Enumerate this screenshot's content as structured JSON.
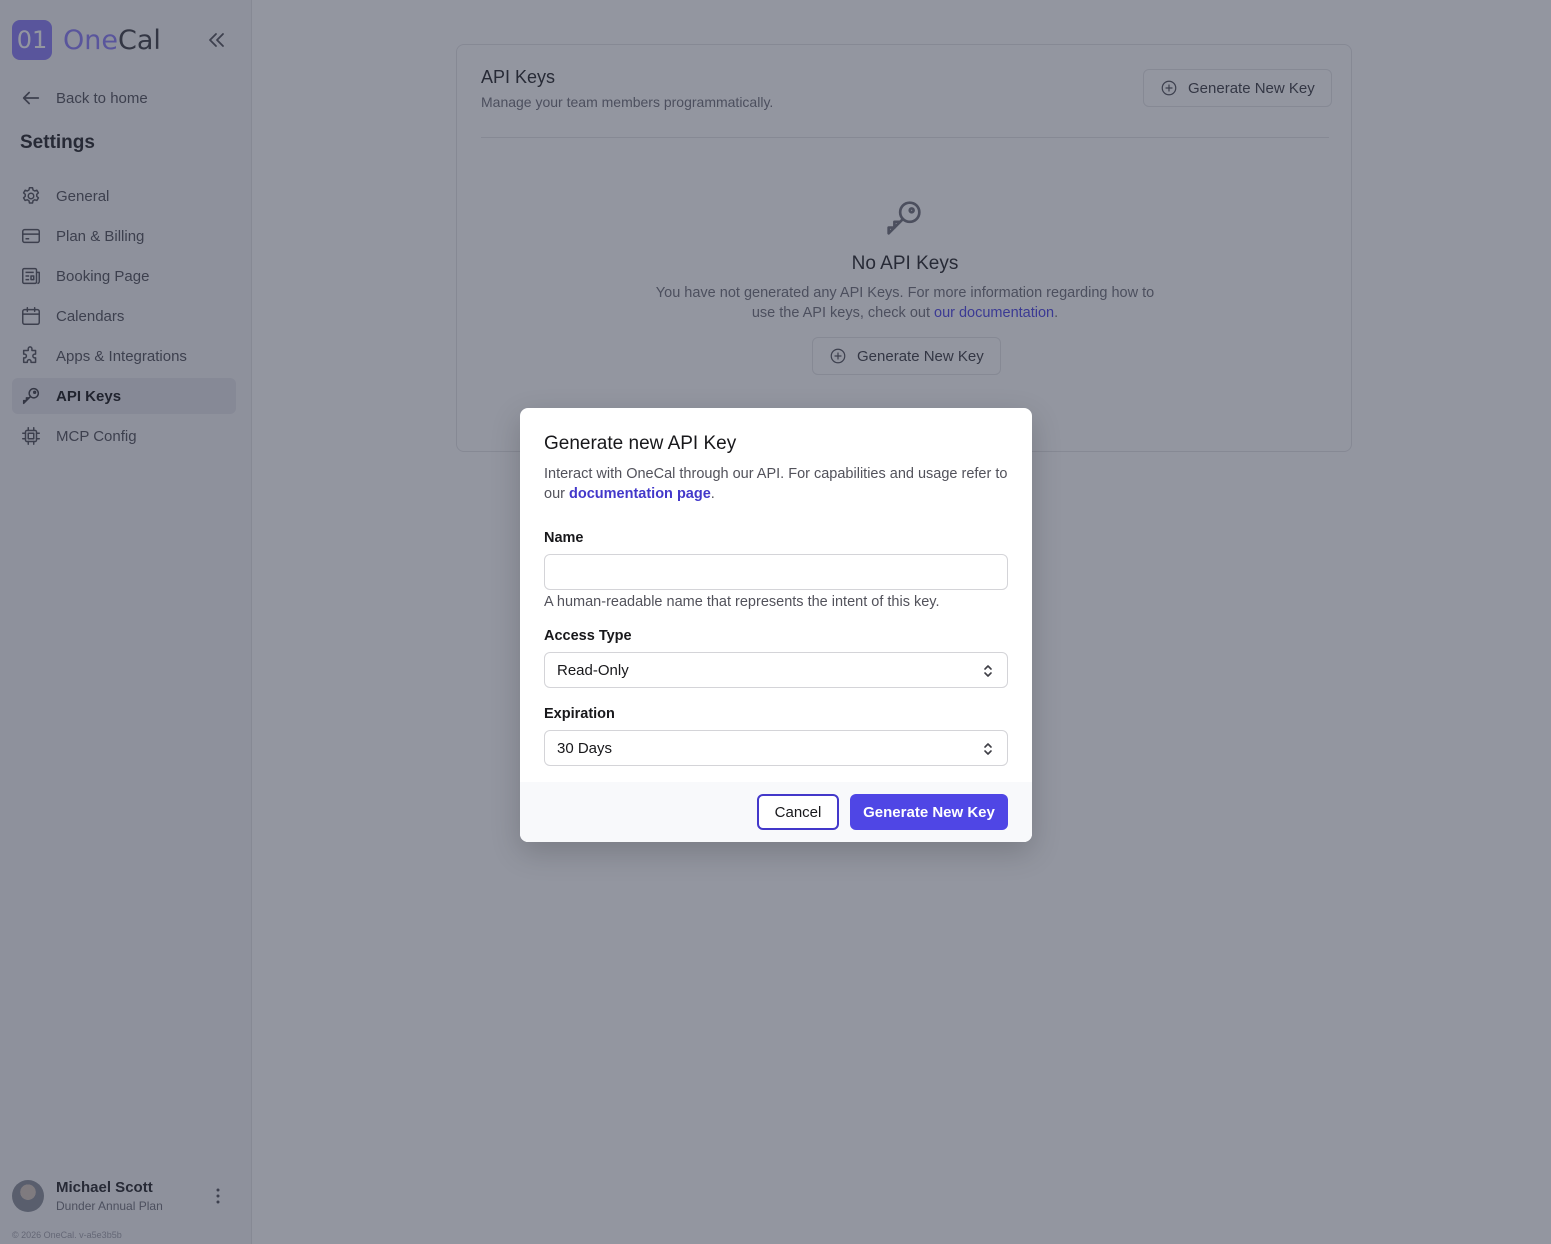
{
  "brand": {
    "logo_badge": "01",
    "logo_part1": "One",
    "logo_part2": "Cal",
    "accent": "#8b7cf6"
  },
  "sidebar": {
    "back_label": "Back to home",
    "section_title": "Settings",
    "items": [
      {
        "label": "General",
        "icon": "gear-icon"
      },
      {
        "label": "Plan & Billing",
        "icon": "credit-card-icon"
      },
      {
        "label": "Booking Page",
        "icon": "newspaper-icon"
      },
      {
        "label": "Calendars",
        "icon": "calendar-icon"
      },
      {
        "label": "Apps & Integrations",
        "icon": "puzzle-icon"
      },
      {
        "label": "API Keys",
        "icon": "key-icon",
        "active": true
      },
      {
        "label": "MCP Config",
        "icon": "cpu-chip-icon"
      }
    ],
    "user": {
      "name": "Michael Scott",
      "plan": "Dunder Annual Plan"
    },
    "copyright": "© 2026 OneCal. v-a5e3b5b"
  },
  "page": {
    "title": "API Keys",
    "subtitle": "Manage your team members programmatically.",
    "header_button": "Generate New Key",
    "empty": {
      "title": "No API Keys",
      "desc_pre": "You have not generated any API Keys. For more information regarding how to use the API keys, check out ",
      "desc_link": "our documentation",
      "desc_post": ".",
      "button": "Generate New Key"
    }
  },
  "modal": {
    "title": "Generate new API Key",
    "desc_pre": "Interact with OneCal through our API. For capabilities and usage refer to our ",
    "desc_link": "documentation page",
    "desc_post": ".",
    "name_label": "Name",
    "name_value": "",
    "name_help": "A human-readable name that represents the intent of this key.",
    "access_label": "Access Type",
    "access_value": "Read-Only",
    "expiration_label": "Expiration",
    "expiration_value": "30 Days",
    "cancel": "Cancel",
    "submit": "Generate New Key",
    "primary_color": "#4f46e5"
  }
}
